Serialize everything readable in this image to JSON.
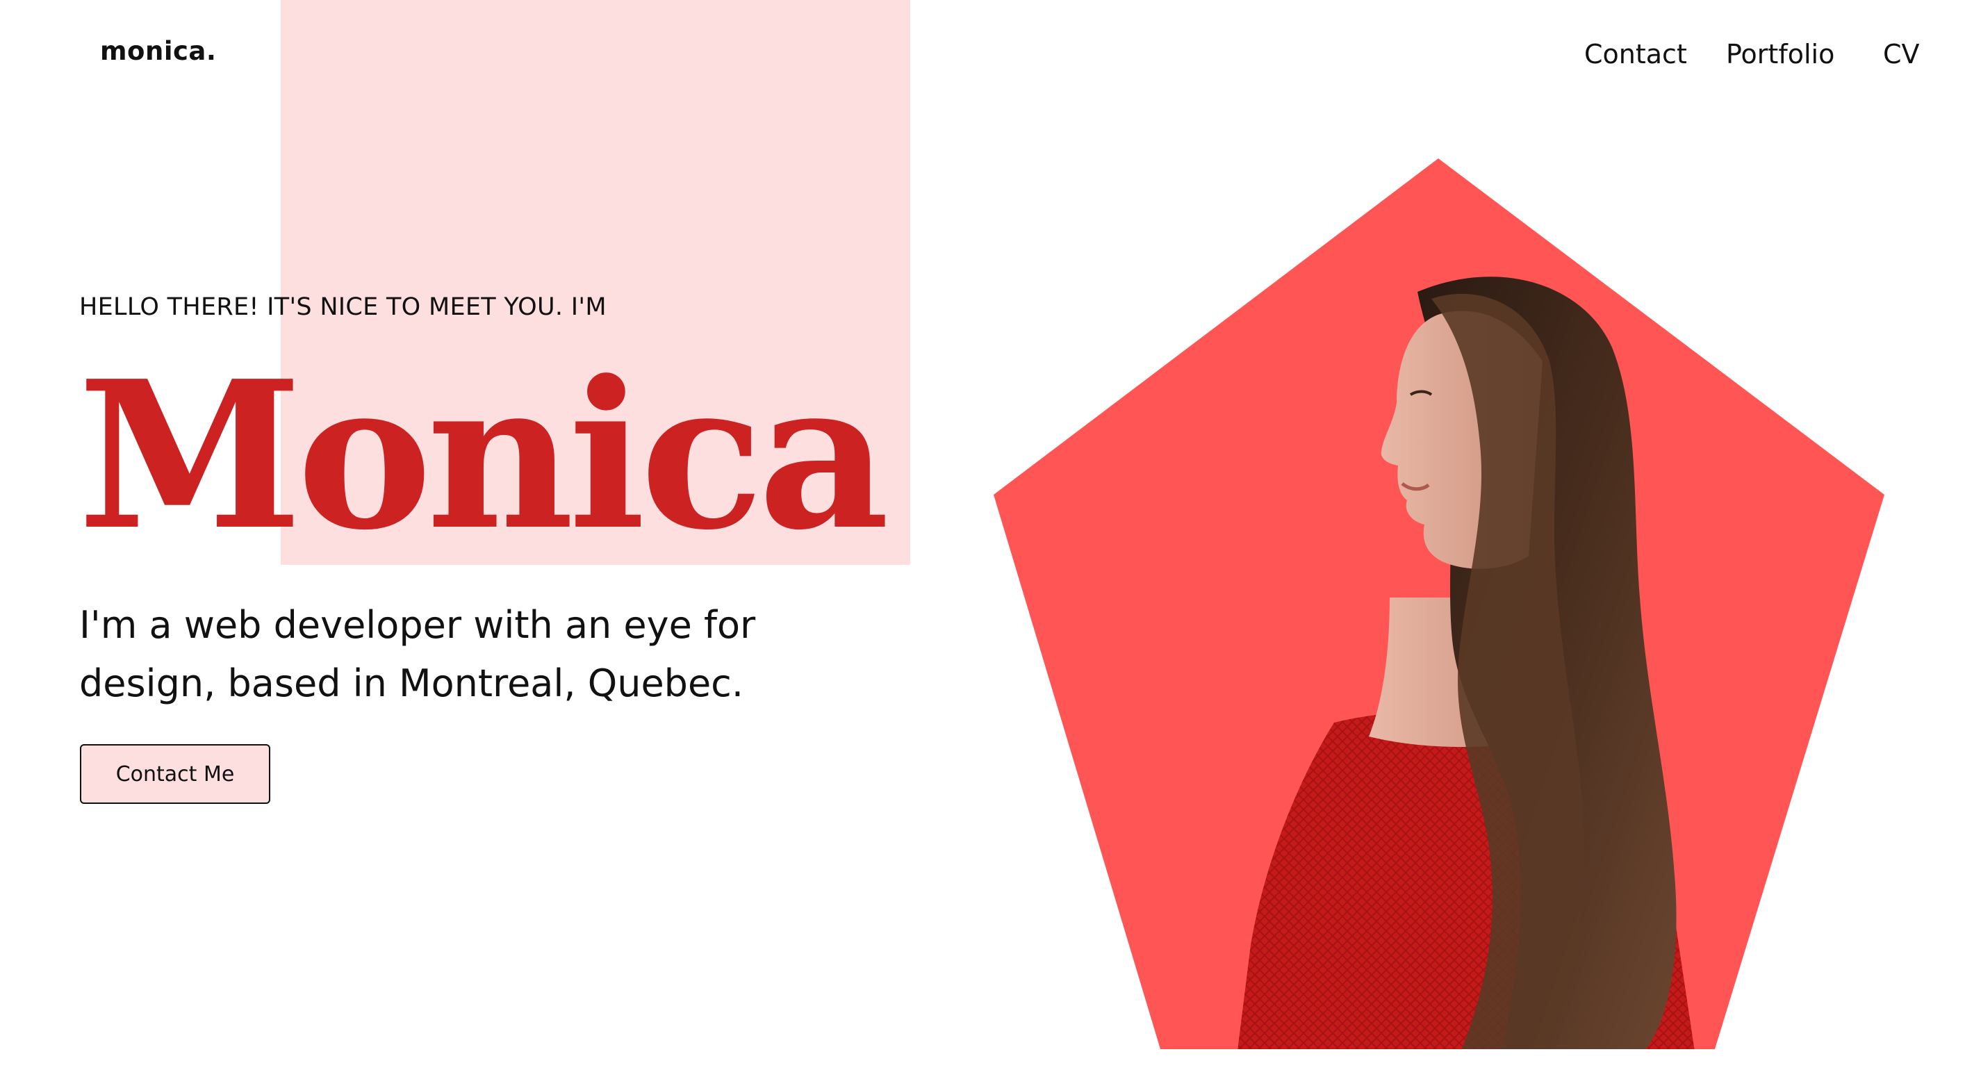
{
  "header": {
    "logo": "monica.",
    "nav": [
      {
        "label": "Contact"
      },
      {
        "label": "Portfolio"
      },
      {
        "label": "CV"
      }
    ]
  },
  "hero": {
    "greeting": "HELLO THERE! IT'S NICE TO MEET YOU. I'M",
    "name": "Monica",
    "tagline": "I'm a web developer with an eye for design, based in Montreal, Quebec.",
    "cta_label": "Contact Me"
  },
  "portrait": {
    "shape": "pentagon",
    "subject": "woman-profile-photo"
  },
  "colors": {
    "accent_red": "#cc2222",
    "pentagon": "#ff5555",
    "pink_block": "#fddfdf",
    "button_fill": "#fddfdf",
    "text": "#111111",
    "background": "#ffffff"
  }
}
